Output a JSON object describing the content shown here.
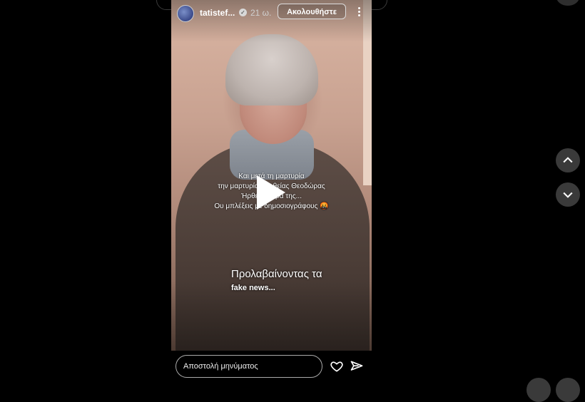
{
  "story": {
    "username": "tatistef...",
    "verified_mark": "✓",
    "time": "21 ω.",
    "follow_label": "Ακολουθήστε",
    "captions": [
      "Και μετά τη μαρτυρία",
      "την μαρτυρία της θείας Θεοδώρας",
      "Ήρθε η σειρά της...",
      "Ου μπλέξεις με δημοσιογράφους 🤬"
    ],
    "overlay_line1": "Προλαβαίνοντας τα",
    "overlay_line2": "fake news..."
  },
  "bottom": {
    "message_placeholder": "Αποστολή μηνύματος"
  },
  "icons": {
    "more": "more-icon",
    "play": "play-icon",
    "heart": "heart-icon",
    "send": "send-icon",
    "nav_up": "chevron-up-icon",
    "nav_down": "chevron-down-icon"
  }
}
